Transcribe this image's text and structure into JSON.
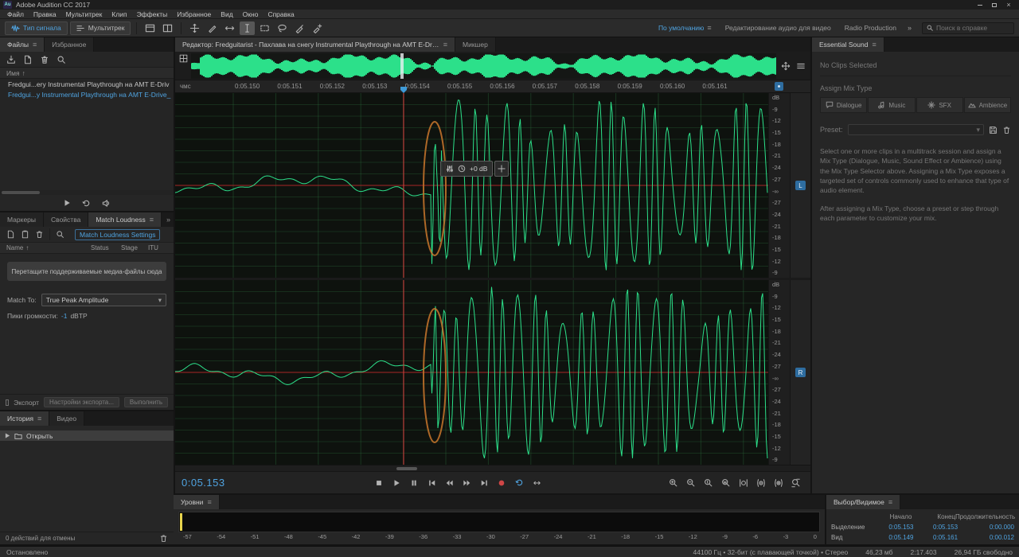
{
  "window": {
    "icon_text": "Au",
    "title": "Adobe Audition CC 2017"
  },
  "menubar": {
    "items": [
      "Файл",
      "Правка",
      "Мультитрек",
      "Клип",
      "Эффекты",
      "Избранное",
      "Вид",
      "Окно",
      "Справка"
    ]
  },
  "toolbar": {
    "waveform_button": "Тип сигнала",
    "multitrack_button": "Мультитрек",
    "workspace_default": "По умолчанию",
    "workspace_audio_video": "Редактирование аудио для видео",
    "workspace_radio": "Radio Production",
    "overflow_chevrons": "»",
    "search_placeholder": "Поиск в справке"
  },
  "files_panel": {
    "tab_files": "Файлы",
    "tab_favorites": "Избранное",
    "name_header": "Имя",
    "sort_arrow": "↑",
    "file1": "Fredgui...ery Instrumental Playthrough на AMT E-Driv",
    "file2": "Fredgui...y Instrumental Playthrough на AMT E-Drive_"
  },
  "loudness_panel": {
    "tab_markers": "Маркеры",
    "tab_properties": "Свойства",
    "tab_match": "Match Loudness",
    "settings_button": "Match Loudness Settings",
    "col_name": "Name",
    "col_status": "Status",
    "col_stage": "Stage",
    "col_itu": "ITU",
    "dropzone_text": "Перетащите поддерживаемые медиа-файлы сюда",
    "match_to_label": "Match To:",
    "match_to_value": "True Peak Amplitude",
    "peaks_label": "Пики громкости:",
    "peaks_value": "-1",
    "peaks_unit": "dBTP",
    "export_checkbox": "Экспорт",
    "export_settings_button": "Настройки экспорта...",
    "run_button": "Выполнить"
  },
  "history_panel": {
    "tab_history": "История",
    "tab_video": "Видео",
    "open_item": "Открыть",
    "undo_status": "0 действий для отмены"
  },
  "editor": {
    "tab_editor": "Редактор: Fredguitarist - Пахлава на снегу Instrumental Playthrough на AMT E-Drive_audio *",
    "tab_mixer": "Микшер",
    "ruler_unit": "чмс",
    "ruler_labels": [
      "0:05.150",
      "0:05.151",
      "0:05.152",
      "0:05.153",
      "0:05.154",
      "0:05.155",
      "0:05.156",
      "0:05.157",
      "0:05.158",
      "0:05.159",
      "0:05.160",
      "0:05.161"
    ],
    "db_scale": [
      "dB",
      "-9",
      "-12",
      "-15",
      "-18",
      "-21",
      "-24",
      "-27",
      "-∞",
      "-27",
      "-24",
      "-21",
      "-18",
      "-15",
      "-12",
      "-9"
    ],
    "left_channel": "L",
    "right_channel": "R",
    "hud_gain": "+0 dB",
    "time_display": "0:05.153"
  },
  "levels_panel": {
    "title": "Уровни",
    "scale": [
      "-57",
      "-54",
      "-51",
      "-48",
      "-45",
      "-42",
      "-39",
      "-36",
      "-33",
      "-30",
      "-27",
      "-24",
      "-21",
      "-18",
      "-15",
      "-12",
      "-9",
      "-6",
      "-3",
      "0"
    ]
  },
  "selection_panel": {
    "title": "Выбор/Видимое",
    "col_start": "Начало",
    "col_end": "Конец",
    "col_duration": "Продолжительность",
    "row_selection_label": "Выделение",
    "sel_start": "0:05.153",
    "sel_end": "0:05.153",
    "sel_duration": "0:00.000",
    "row_view_label": "Вид",
    "view_start": "0:05.149",
    "view_end": "0:05.161",
    "view_duration": "0:00.012"
  },
  "essential_sound": {
    "title": "Essential Sound",
    "no_clips": "No Clips Selected",
    "assign_label": "Assign Mix Type",
    "dialogue": "Dialogue",
    "music": "Music",
    "sfx": "SFX",
    "ambience": "Ambience",
    "preset_label": "Preset:",
    "description_1": "Select one or more clips in a multitrack session and assign a Mix Type (Dialogue, Music, Sound Effect or Ambience) using the Mix Type Selector above. Assigning a Mix Type exposes a targeted set of controls commonly used to enhance that type of audio element.",
    "description_2": "After assigning a Mix Type, choose a preset or step through each parameter to customize your mix."
  },
  "statusbar": {
    "state": "Остановлено",
    "format": "44100 Гц • 32-бит (с плавающей точкой) • Стерео",
    "file_size": "46,23 мб",
    "total_duration": "2:17.403",
    "free_space": "26,94 ГБ свободно"
  },
  "colors": {
    "waveform_green": "#2ce08a",
    "accent_blue": "#4fa3e0",
    "playhead_red": "#d83a3a",
    "record_red": "#cf4646",
    "annotation_orange": "#c9772b",
    "meter_yellow": "#e8d44d"
  }
}
